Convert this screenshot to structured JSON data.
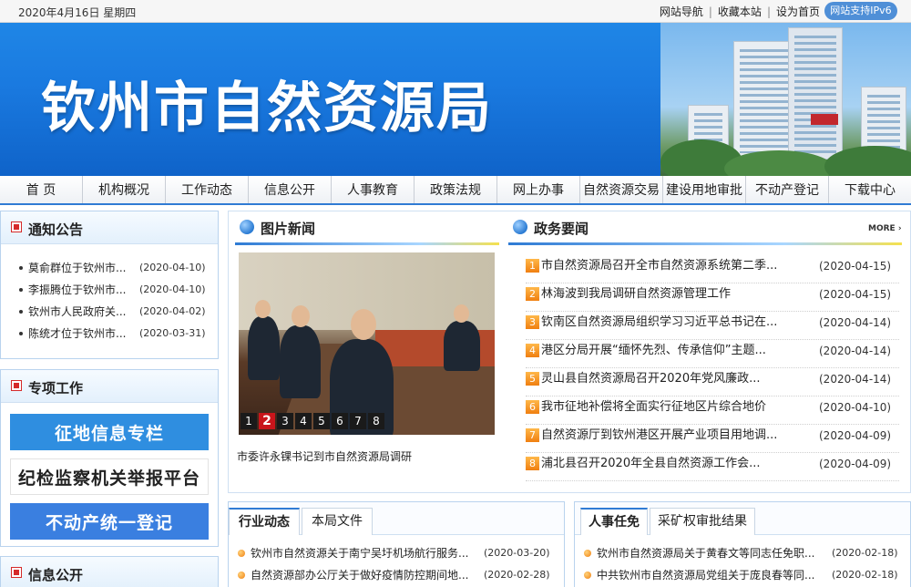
{
  "topbar": {
    "date": "2020年4月16日 星期四",
    "links": [
      "网站导航",
      "收藏本站",
      "设为首页"
    ],
    "separator": "|",
    "ipv6_badge": "网站支持IPv6"
  },
  "banner": {
    "site_title": "钦州市自然资源局"
  },
  "nav": {
    "items": [
      "首 页",
      "机构概况",
      "工作动态",
      "信息公开",
      "人事教育",
      "政策法规",
      "网上办事",
      "自然资源交易",
      "建设用地审批",
      "不动产登记",
      "下载中心"
    ]
  },
  "notice": {
    "title": "通知公告",
    "items": [
      {
        "title": "莫俞群位于钦州市...",
        "date": "(2020-04-10)"
      },
      {
        "title": "李振腾位于钦州市...",
        "date": "(2020-04-10)"
      },
      {
        "title": "钦州市人民政府关...",
        "date": "(2020-04-02)"
      },
      {
        "title": "陈统才位于钦州市...",
        "date": "(2020-03-31)"
      }
    ]
  },
  "special": {
    "title": "专项工作",
    "banners": [
      {
        "label": "征地信息专栏",
        "bg": "#2f8ee0",
        "fg": "#ffffff"
      },
      {
        "label": "纪检监察机关举报平台",
        "bg": "#ffffff",
        "fg": "#222222"
      },
      {
        "label": "不动产统一登记",
        "bg": "#3a7fe0",
        "fg": "#ffffff"
      }
    ]
  },
  "info_open": {
    "title": "信息公开"
  },
  "photo_news": {
    "title": "图片新闻",
    "pages": [
      "1",
      "2",
      "3",
      "4",
      "5",
      "6",
      "7",
      "8"
    ],
    "active_page": "2",
    "caption": "市委许永锞书记到市自然资源局调研"
  },
  "gov_news": {
    "title": "政务要闻",
    "more": "MORE ›",
    "items": [
      {
        "num": "1",
        "title": "市自然资源局召开全市自然资源系统第二季...",
        "date": "(2020-04-15)"
      },
      {
        "num": "2",
        "title": "林海波到我局调研自然资源管理工作",
        "date": "(2020-04-15)"
      },
      {
        "num": "3",
        "title": "钦南区自然资源局组织学习习近平总书记在...",
        "date": "(2020-04-14)"
      },
      {
        "num": "4",
        "title": "港区分局开展“缅怀先烈、传承信仰”主题...",
        "date": "(2020-04-14)"
      },
      {
        "num": "5",
        "title": "灵山县自然资源局召开2020年党风廉政...",
        "date": "(2020-04-14)"
      },
      {
        "num": "6",
        "title": "我市征地补偿将全面实行征地区片综合地价",
        "date": "(2020-04-10)"
      },
      {
        "num": "7",
        "title": "自然资源厅到钦州港区开展产业项目用地调...",
        "date": "(2020-04-09)"
      },
      {
        "num": "8",
        "title": "浦北县召开2020年全县自然资源工作会...",
        "date": "(2020-04-09)"
      }
    ]
  },
  "industry": {
    "tabs": [
      "行业动态",
      "本局文件"
    ],
    "items": [
      {
        "title": "钦州市自然资源关于南宁吴圩机场航行服务...",
        "date": "(2020-03-20)"
      },
      {
        "title": "自然资源部办公厅关于做好疫情防控期间地...",
        "date": "(2020-02-28)"
      }
    ]
  },
  "personnel": {
    "tabs": [
      "人事任免",
      "采矿权审批结果"
    ],
    "items": [
      {
        "title": "钦州市自然资源局关于黄春文等同志任免职...",
        "date": "(2020-02-18)"
      },
      {
        "title": "中共钦州市自然资源局党组关于庞良春等同...",
        "date": "(2020-02-18)"
      }
    ]
  }
}
